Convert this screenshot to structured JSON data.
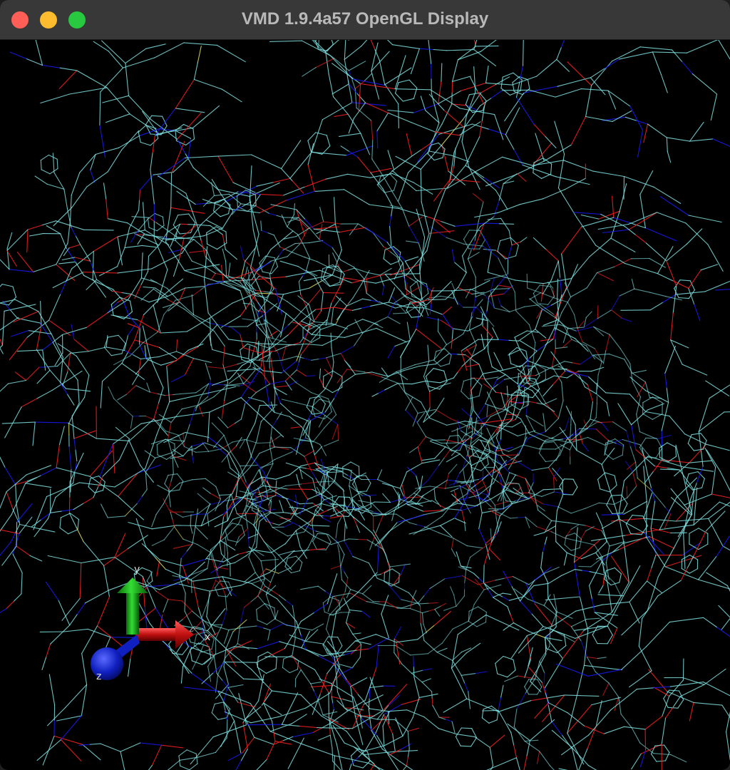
{
  "window": {
    "title": "VMD 1.9.4a57 OpenGL Display",
    "buttons": [
      "close",
      "minimize",
      "zoom"
    ]
  },
  "scene": {
    "background": "#000000",
    "representation": "lines",
    "element_colors": {
      "carbon": "#7fe0e0",
      "nitrogen": "#1a1aff",
      "oxygen": "#ff2020",
      "sulfur": "#e0e060"
    }
  },
  "axes": {
    "x_label": "x",
    "y_label": "y",
    "z_label": "z",
    "colors": {
      "x": "#c01010",
      "y": "#10b010",
      "z": "#1020d0"
    }
  }
}
